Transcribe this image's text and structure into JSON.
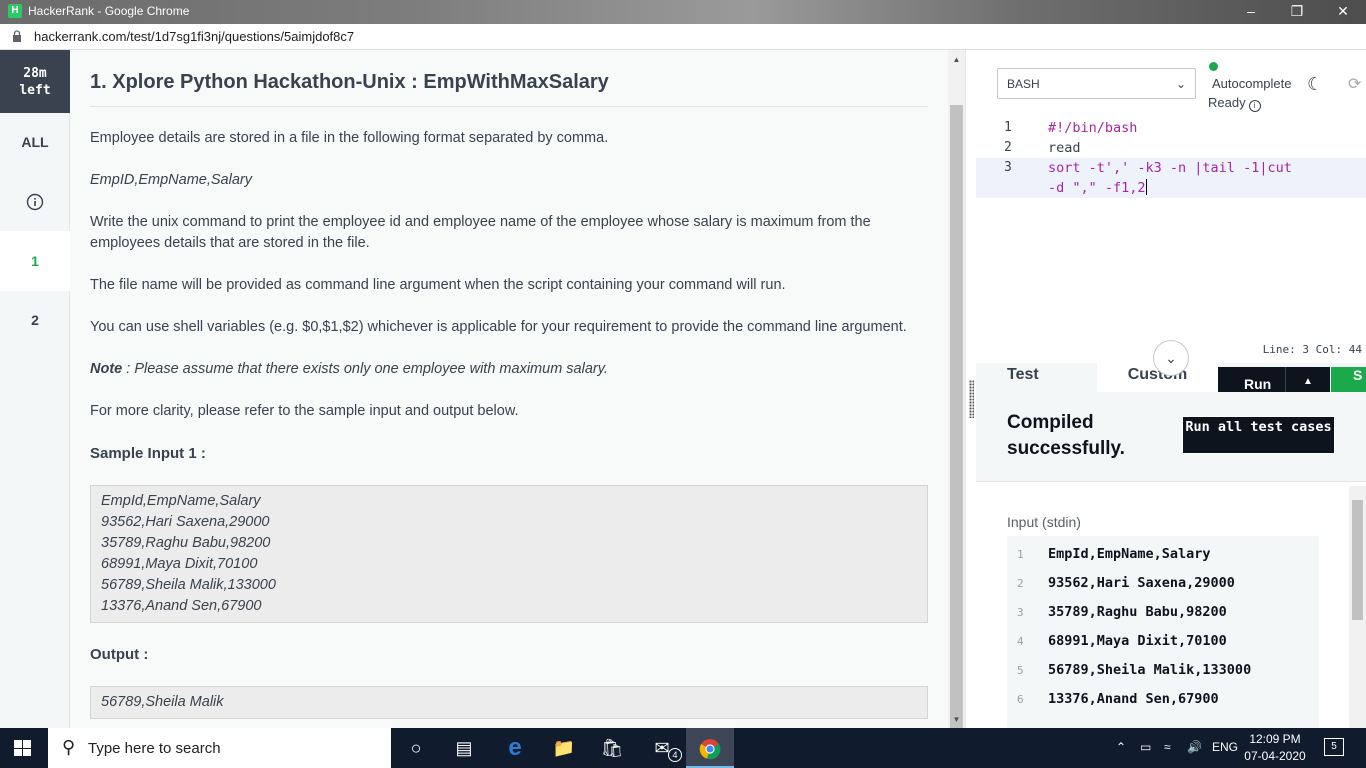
{
  "browser": {
    "window_title": "HackerRank - Google Chrome",
    "favicon_letter": "H",
    "url": "hackerrank.com/test/1d7sg1fi3nj/questions/5aimjdof8c7"
  },
  "sidebar": {
    "timer_value": "28m",
    "timer_unit": "left",
    "items": [
      {
        "label": "ALL"
      },
      {
        "label": "1"
      },
      {
        "label": "2"
      }
    ]
  },
  "problem": {
    "title": "1. Xplore Python Hackathon-Unix : EmpWithMaxSalary",
    "p1": "Employee details are stored in a file in the following format separated by comma.",
    "format": "EmpID,EmpName,Salary",
    "p2": "Write the unix command to print the employee id and employee name of the employee whose salary is maximum from the employees details that are stored in the file.",
    "p3": "The file name will be provided as command line argument when the script containing your command will run.",
    "p4": "You can use shell variables (e.g. $0,$1,$2) whichever is applicable for your requirement to provide the command line argument.",
    "note_label": "Note",
    "note_text": " : Please assume that there exists only one employee with maximum salary.",
    "p5": "For more clarity, please refer to the sample input and output below.",
    "sample_input_heading": "Sample Input 1 :",
    "sample_input_lines": [
      "EmpId,EmpName,Salary",
      "93562,Hari Saxena,29000",
      "35789,Raghu Babu,98200",
      "68991,Maya Dixit,70100",
      "56789,Sheila Malik,133000",
      "13376,Anand Sen,67900"
    ],
    "output_heading": "Output :",
    "output_value": "56789,Sheila Malik"
  },
  "editor": {
    "language": "BASH",
    "autocomplete_label": "Autocomplete",
    "ready_label": "Ready",
    "code_lines": [
      {
        "num": "1",
        "text": "#!/bin/bash"
      },
      {
        "num": "2",
        "text": "read"
      },
      {
        "num": "3",
        "text": "sort -t',' -k3 -n |tail -1|cut"
      },
      {
        "num": "",
        "text": "-d \",\" -f1,2"
      }
    ],
    "cursor_position": "Line: 3 Col: 44"
  },
  "test_panel": {
    "tab_test": "Test",
    "tab_custom": "Custom",
    "run_button": "Run",
    "submit_button": "S",
    "compiled_status": "Compiled successfully.",
    "run_all_button": "Run all test cases",
    "stdin_label": "Input (stdin)",
    "stdin_lines": [
      {
        "num": "1",
        "text": "EmpId,EmpName,Salary"
      },
      {
        "num": "2",
        "text": "93562,Hari Saxena,29000"
      },
      {
        "num": "3",
        "text": "35789,Raghu Babu,98200"
      },
      {
        "num": "4",
        "text": "68991,Maya Dixit,70100"
      },
      {
        "num": "5",
        "text": "56789,Sheila Malik,133000"
      },
      {
        "num": "6",
        "text": "13376,Anand Sen,67900"
      }
    ]
  },
  "taskbar": {
    "search_placeholder": "Type here to search",
    "mail_badge": "4",
    "language": "ENG",
    "time": "12:09 PM",
    "date": "07-04-2020",
    "notification_count": "5"
  },
  "colors": {
    "accent_green": "#1ba94c",
    "dark": "#0e141e",
    "text": "#39424e"
  }
}
